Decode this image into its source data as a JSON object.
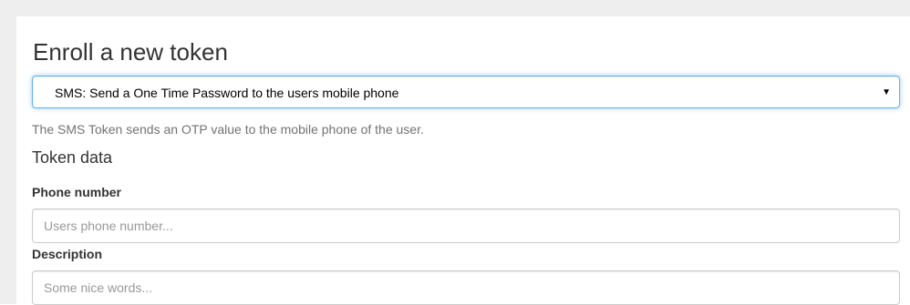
{
  "page": {
    "title": "Enroll a new token"
  },
  "token_type_select": {
    "selected": "SMS: Send a One Time Password to the users mobile phone"
  },
  "token_type_help": "The SMS Token sends an OTP value to the mobile phone of the user.",
  "token_data": {
    "heading": "Token data",
    "phone": {
      "label": "Phone number",
      "value": "",
      "placeholder": "Users phone number..."
    },
    "description": {
      "label": "Description",
      "value": "",
      "placeholder": "Some nice words..."
    }
  },
  "icons": {
    "select_caret": "caret-down-icon"
  },
  "colors": {
    "focus_border": "#66afe9",
    "help_text": "#737373",
    "background_gutter": "#eeeeee"
  }
}
